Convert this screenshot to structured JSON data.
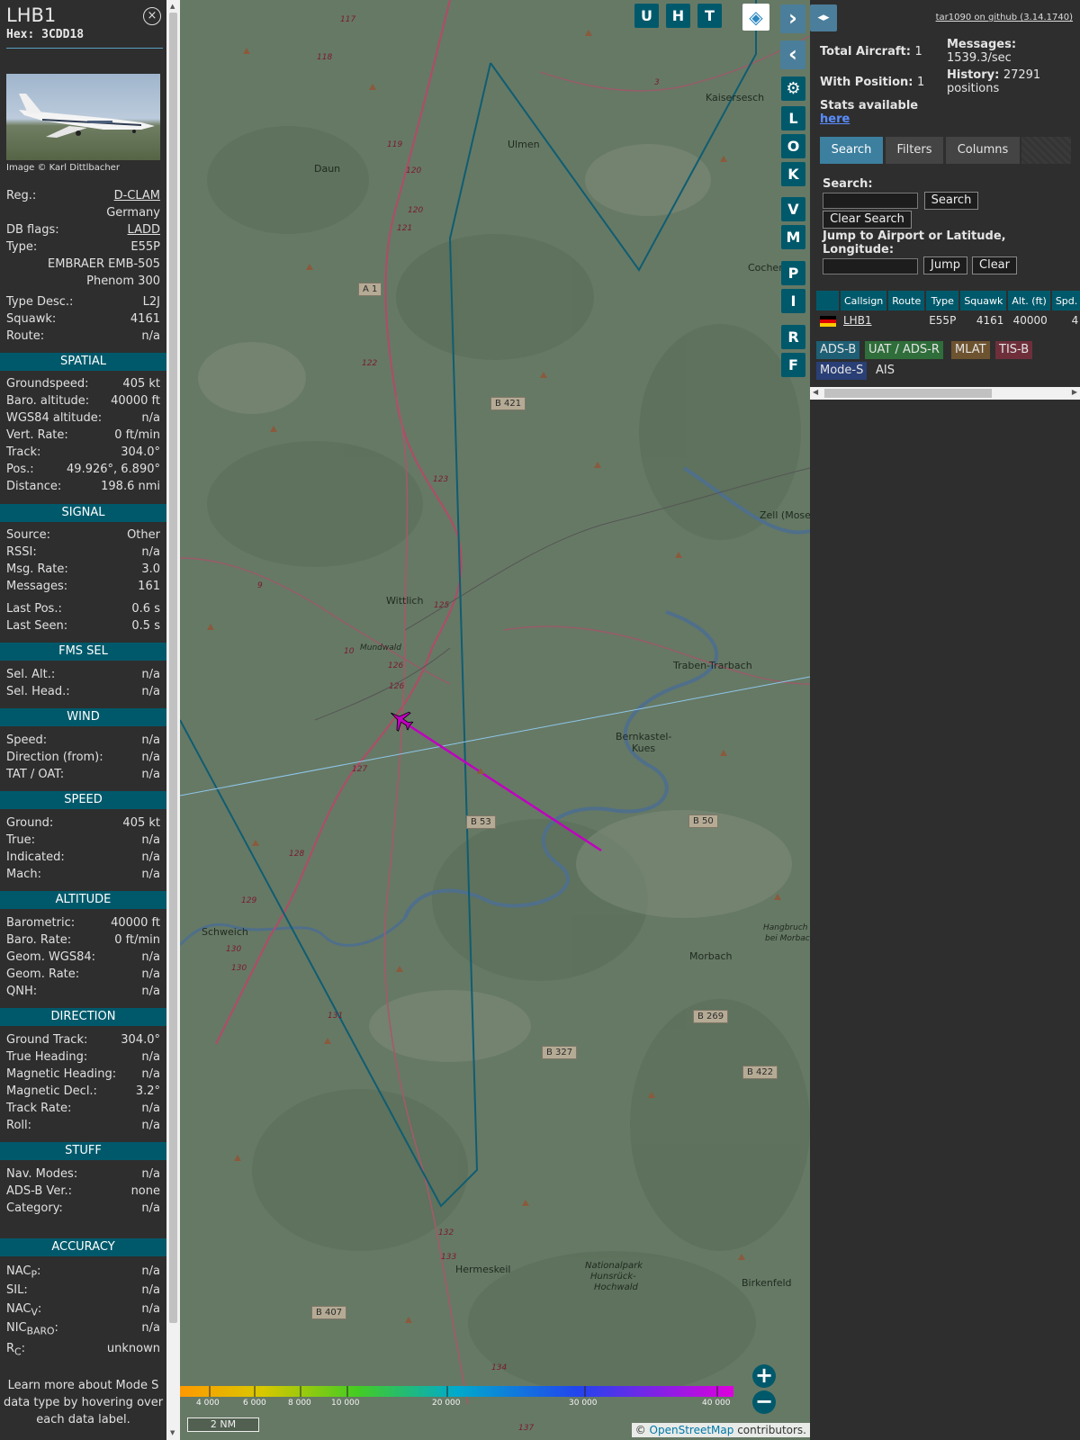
{
  "info": {
    "callsign": "LHB1",
    "hex": "Hex: 3CDD18",
    "close_icon": "×",
    "photo_credit": "Image © Karl Dittlbacher",
    "reg_label": "Reg.:",
    "reg_value": "D-CLAM",
    "country": "Germany",
    "dbflags_label": "DB flags:",
    "dbflags_value": "LADD",
    "type_label": "Type:",
    "type_value": "E55P",
    "type_name_1": "EMBRAER EMB-505",
    "type_name_2": "Phenom 300",
    "typedesc_label": "Type Desc.:",
    "typedesc_value": "L2J",
    "squawk_label": "Squawk:",
    "squawk_value": "4161",
    "route_label": "Route:",
    "route_value": "n/a",
    "sections": {
      "spatial": "SPATIAL",
      "signal": "SIGNAL",
      "fms": "FMS SEL",
      "wind": "WIND",
      "speed": "SPEED",
      "altitude": "ALTITUDE",
      "direction": "DIRECTION",
      "stuff": "STUFF",
      "accuracy": "ACCURACY"
    },
    "spatial": [
      {
        "k": "Groundspeed:",
        "v": "405 kt"
      },
      {
        "k": "Baro. altitude:",
        "v": "40000 ft"
      },
      {
        "k": "WGS84 altitude:",
        "v": "n/a"
      },
      {
        "k": "Vert. Rate:",
        "v": "0 ft/min"
      },
      {
        "k": "Track:",
        "v": "304.0°"
      },
      {
        "k": "Pos.:",
        "v": "49.926°, 6.890°"
      },
      {
        "k": "Distance:",
        "v": "198.6 nmi"
      }
    ],
    "signal": [
      {
        "k": "Source:",
        "v": "Other"
      },
      {
        "k": "RSSI:",
        "v": "n/a"
      },
      {
        "k": "Msg. Rate:",
        "v": "3.0"
      },
      {
        "k": "Messages:",
        "v": "161"
      },
      {
        "k": "Last Pos.:",
        "v": "0.6 s"
      },
      {
        "k": "Last Seen:",
        "v": "0.5 s"
      }
    ],
    "fms": [
      {
        "k": "Sel. Alt.:",
        "v": "n/a"
      },
      {
        "k": "Sel. Head.:",
        "v": "n/a"
      }
    ],
    "wind": [
      {
        "k": "Speed:",
        "v": "n/a"
      },
      {
        "k": "Direction (from):",
        "v": "n/a"
      },
      {
        "k": "TAT / OAT:",
        "v": "n/a"
      }
    ],
    "speed": [
      {
        "k": "Ground:",
        "v": "405 kt"
      },
      {
        "k": "True:",
        "v": "n/a"
      },
      {
        "k": "Indicated:",
        "v": "n/a"
      },
      {
        "k": "Mach:",
        "v": "n/a"
      }
    ],
    "altitude": [
      {
        "k": "Barometric:",
        "v": "40000 ft"
      },
      {
        "k": "Baro. Rate:",
        "v": "0 ft/min"
      },
      {
        "k": "Geom. WGS84:",
        "v": "n/a"
      },
      {
        "k": "Geom. Rate:",
        "v": "n/a"
      },
      {
        "k": "QNH:",
        "v": "n/a"
      }
    ],
    "direction": [
      {
        "k": "Ground Track:",
        "v": "304.0°"
      },
      {
        "k": "True Heading:",
        "v": "n/a"
      },
      {
        "k": "Magnetic Heading:",
        "v": "n/a"
      },
      {
        "k": "Magnetic Decl.:",
        "v": "3.2°"
      },
      {
        "k": "Track Rate:",
        "v": "n/a"
      },
      {
        "k": "Roll:",
        "v": "n/a"
      }
    ],
    "stuff": [
      {
        "k": "Nav. Modes:",
        "v": "n/a"
      },
      {
        "k": "ADS-B Ver.:",
        "v": "none"
      },
      {
        "k": "Category:",
        "v": "n/a"
      }
    ],
    "accuracy": {
      "nacp_k": "NAC",
      "nacp_sub": "P",
      "nacp_v": "n/a",
      "sil_k": "SIL:",
      "sil_v": "n/a",
      "nacv_k": "NAC",
      "nacv_sub": "V",
      "nacv_v": "n/a",
      "nicbaro_k": "NIC",
      "nicbaro_sub": "BARO",
      "nicbaro_v": "n/a",
      "rc_k": "R",
      "rc_sub": "C",
      "rc_v": "unknown"
    },
    "learn_more": "Learn more about Mode S data type by hovering over each data label."
  },
  "map": {
    "places": [
      {
        "id": "kaisersesch",
        "text": "Kaisersesch"
      },
      {
        "id": "ulmen",
        "text": "Ulmen"
      },
      {
        "id": "daun",
        "text": "Daun"
      },
      {
        "id": "cochem",
        "text": "Cocher"
      },
      {
        "id": "zell",
        "text": "Zell (Mosel"
      },
      {
        "id": "wittlich",
        "text": "Wittlich"
      },
      {
        "id": "mundwald",
        "text": "Mundwald"
      },
      {
        "id": "traben",
        "text": "Traben-Trarbach"
      },
      {
        "id": "bernkastel1",
        "text": "Bernkastel-"
      },
      {
        "id": "bernkastel2",
        "text": "Kues"
      },
      {
        "id": "schweich",
        "text": "Schweich"
      },
      {
        "id": "morbach",
        "text": "Morbach"
      },
      {
        "id": "hangbruch1",
        "text": "Hangbruch"
      },
      {
        "id": "hangbruch2",
        "text": "bei Morbac"
      },
      {
        "id": "hermeskeil",
        "text": "Hermeskeil"
      },
      {
        "id": "birkenfeld",
        "text": "Birkenfeld"
      },
      {
        "id": "np1",
        "text": "Nationalpark"
      },
      {
        "id": "np2",
        "text": "Hunsrück-"
      },
      {
        "id": "np3",
        "text": "Hochwald"
      }
    ],
    "roads": [
      "A 1",
      "B 421",
      "B 53",
      "B 50",
      "B 269",
      "B 327",
      "B 422",
      "B 407"
    ],
    "route_numbers": [
      "117",
      "118",
      "119",
      "120",
      "120",
      "121",
      "122",
      "123",
      "125",
      "126",
      "126",
      "127",
      "128",
      "129",
      "130",
      "130",
      "131",
      "132",
      "133",
      "134",
      "137",
      "3",
      "9",
      "10"
    ],
    "buttons": {
      "u": "U",
      "h": "H",
      "t": "T",
      "l": "L",
      "o": "O",
      "k": "K",
      "v": "V",
      "m": "M",
      "p": "P",
      "i": "I",
      "r": "R",
      "f": "F",
      "next": "›",
      "prev": "‹",
      "expand": "◂▸",
      "settings": "⚙",
      "zoom_in": "+",
      "zoom_out": "−",
      "layers": "◈"
    },
    "altitude_scale": [
      "4 000",
      "6 000",
      "8 000",
      "10 000",
      "20 000",
      "30 000",
      "40 000"
    ],
    "scale_label": "2 NM",
    "attribution_pre": "© ",
    "attribution_link": "OpenStreetMap",
    "attribution_post": " contributors."
  },
  "right": {
    "github": "tar1090 on github (3.14.1740)",
    "total_label": "Total Aircraft:",
    "total_value": "1",
    "withpos_label": "With Position:",
    "withpos_value": "1",
    "messages_label": "Messages:",
    "messages_value": "1539.3/sec",
    "history_label": "History:",
    "history_value": "27291",
    "history_unit": "positions",
    "stats_label": "Stats available",
    "stats_link": "here",
    "tabs": [
      "Search",
      "Filters",
      "Columns"
    ],
    "search_label": "Search:",
    "search_button": "Search",
    "clear_search_button": "Clear Search",
    "jump_label": "Jump to Airport or Latitude, Longitude:",
    "jump_button": "Jump",
    "clear_button": "Clear",
    "table_headers": [
      "",
      "Callsign",
      "Route",
      "Type",
      "Squawk",
      "Alt. (ft)",
      "Spd."
    ],
    "table_rows": [
      {
        "callsign": "LHB1",
        "route": "",
        "type": "E55P",
        "squawk": "4161",
        "alt": "40000",
        "spd": "4"
      }
    ],
    "sources": [
      {
        "label": "ADS-B",
        "color": "#1e5f75"
      },
      {
        "label": "UAT / ADS-R",
        "color": "#2f6e3a"
      },
      {
        "label": "MLAT",
        "color": "#6e5330"
      },
      {
        "label": "TIS-B",
        "color": "#6e2f3b"
      },
      {
        "label": "Mode-S",
        "color": "#2a3f75"
      },
      {
        "label": "AIS",
        "color": "#2e2e2e"
      }
    ]
  }
}
